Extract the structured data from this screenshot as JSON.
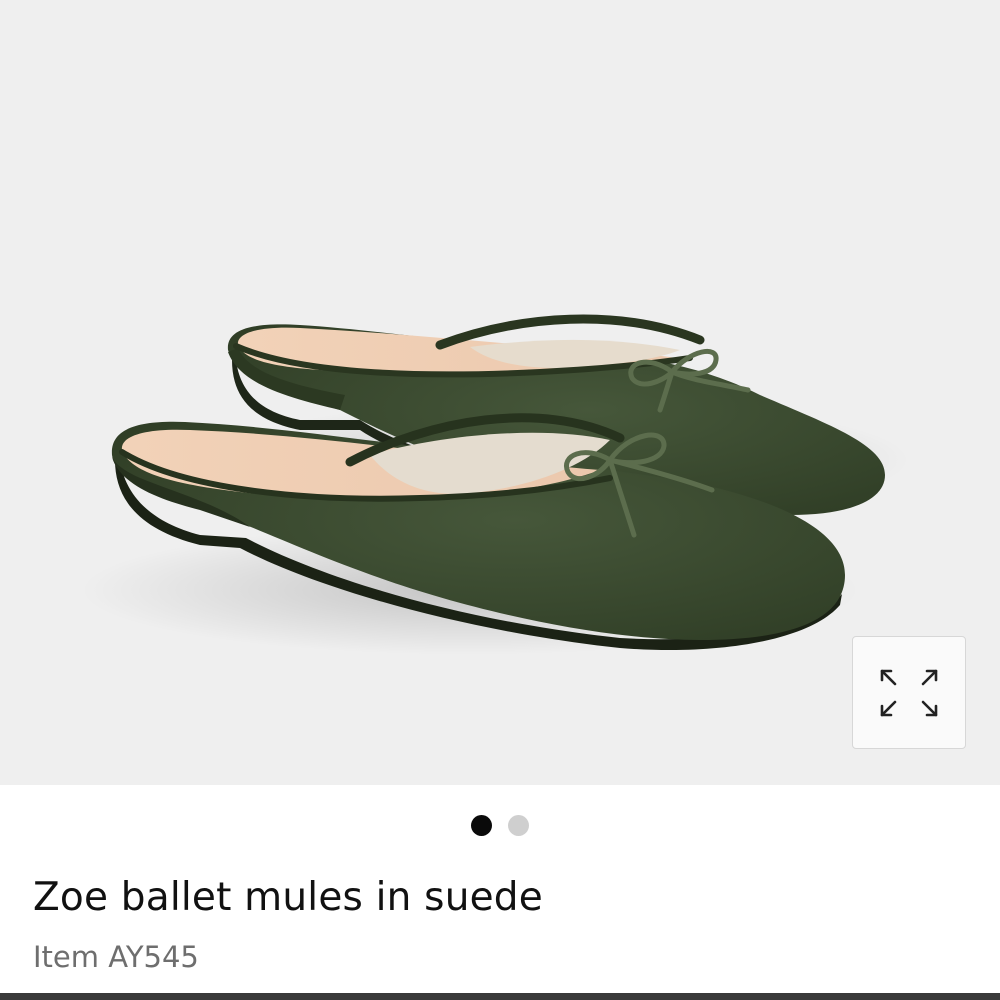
{
  "gallery": {
    "image_alt": "Zoe ballet mules in suede",
    "expand_label": "Expand image",
    "current_slide": 1,
    "slides": [
      {
        "label": "Image 1"
      },
      {
        "label": "Image 2"
      }
    ]
  },
  "product": {
    "title": "Zoe ballet mules in suede",
    "item_number": "Item AY545"
  },
  "colors": {
    "gallery_background": "#efefef",
    "suede": "#3a4a2d",
    "lining": "#f0cfb5",
    "active_dot": "#0a0a0a",
    "inactive_dot": "#cfcfcf"
  },
  "icons": {
    "expand": "expand-arrows-icon"
  }
}
